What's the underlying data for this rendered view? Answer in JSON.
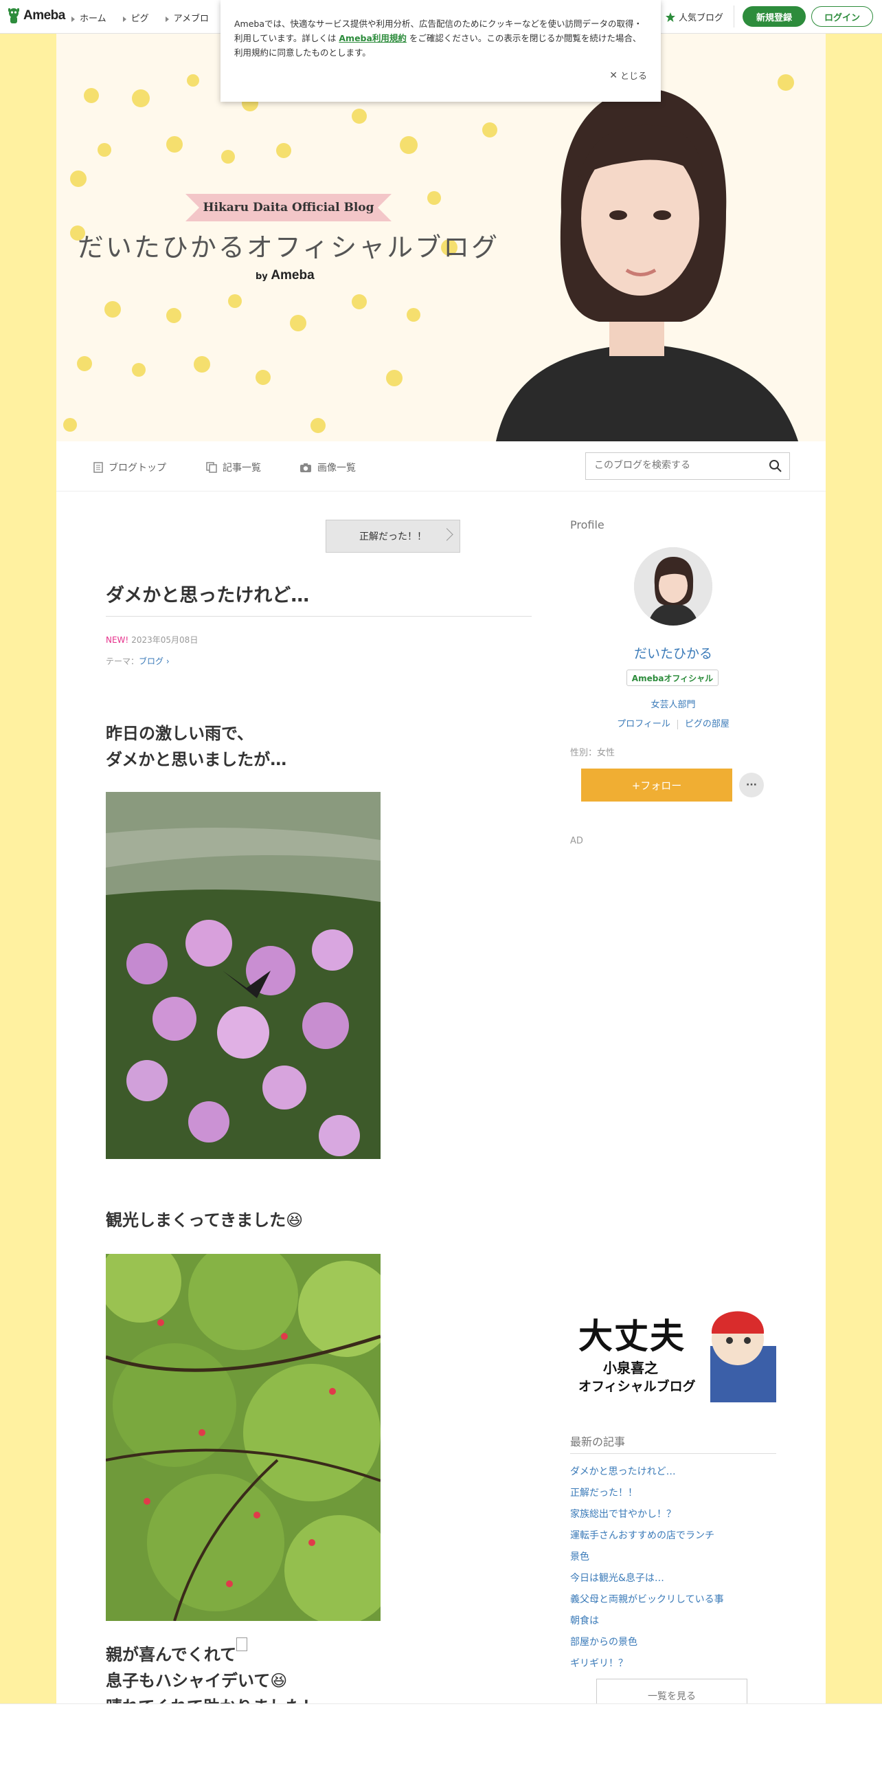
{
  "header": {
    "logo_text": "Ameba",
    "nav": [
      "ホーム",
      "ピグ",
      "アメブロ"
    ],
    "popular_label": "人気ブログ",
    "signup_label": "新規登録",
    "login_label": "ログイン"
  },
  "cookie_notice": {
    "text_before": "Amebaでは、快適なサービス提供や利用分析、広告配信のためにクッキーなどを使い訪問データの取得・利用しています。詳しくは",
    "link_text": "Ameba利用規約",
    "text_after": "をご確認ください。この表示を閉じるか閲覧を続けた場合、利用規約に同意したものとします。",
    "close_label": "とじる"
  },
  "hero": {
    "ribbon_text": "Hikaru Daita Official Blog",
    "title": "だいたひかるオフィシャルブログ",
    "by_prefix": "by",
    "by_brand": "Ameba"
  },
  "blognav": {
    "items": [
      "ブログトップ",
      "記事一覧",
      "画像一覧"
    ],
    "search_placeholder": "このブログを検索する"
  },
  "article": {
    "prev_label": "正解だった！！",
    "title": "ダメかと思ったけれど…",
    "new_badge": "NEW!",
    "date": "2023年05月08日",
    "theme_prefix": "テーマ：",
    "theme": "ブログ",
    "paragraph1_line1": "昨日の激しい雨で、",
    "paragraph1_line2": "ダメかと思いましたが…",
    "paragraph2": "観光しまくってきました😆",
    "paragraph3_line1": "親が喜んでくれて",
    "paragraph3_line2": "息子もハシャイデいて😆",
    "paragraph3_line3": "晴れてくれて助かりました！"
  },
  "sidebar": {
    "profile_heading": "Profile",
    "name": "だいたひかる",
    "official_badge": "Amebaオフィシャル",
    "department": "女芸人部門",
    "link_profile": "プロフィール",
    "link_pigg": "ピグの部屋",
    "gender": "性別：女性",
    "follow_label": "+フォロー",
    "more_label": "···",
    "ad_label": "AD",
    "banner_title": "大丈夫",
    "banner_sub1": "小泉喜之",
    "banner_sub2": "オフィシャルブログ",
    "latest_heading": "最新の記事",
    "latest": [
      "ダメかと思ったけれど…",
      "正解だった！！",
      "家族総出で甘やかし！？",
      "運転手さんおすすめの店でランチ",
      "景色",
      "今日は観光&息子は…",
      "義父母と両親がビックリしている事",
      "朝食は",
      "部屋からの景色",
      "ギリギリ！？"
    ],
    "see_all_label": "一覧を見る"
  },
  "colors": {
    "brand_green": "#2d8c3c",
    "follow_orange": "#f0ae33",
    "link_blue": "#3a7ab8",
    "new_pink": "#e6308b",
    "background_yellow": "#fff1a0"
  }
}
